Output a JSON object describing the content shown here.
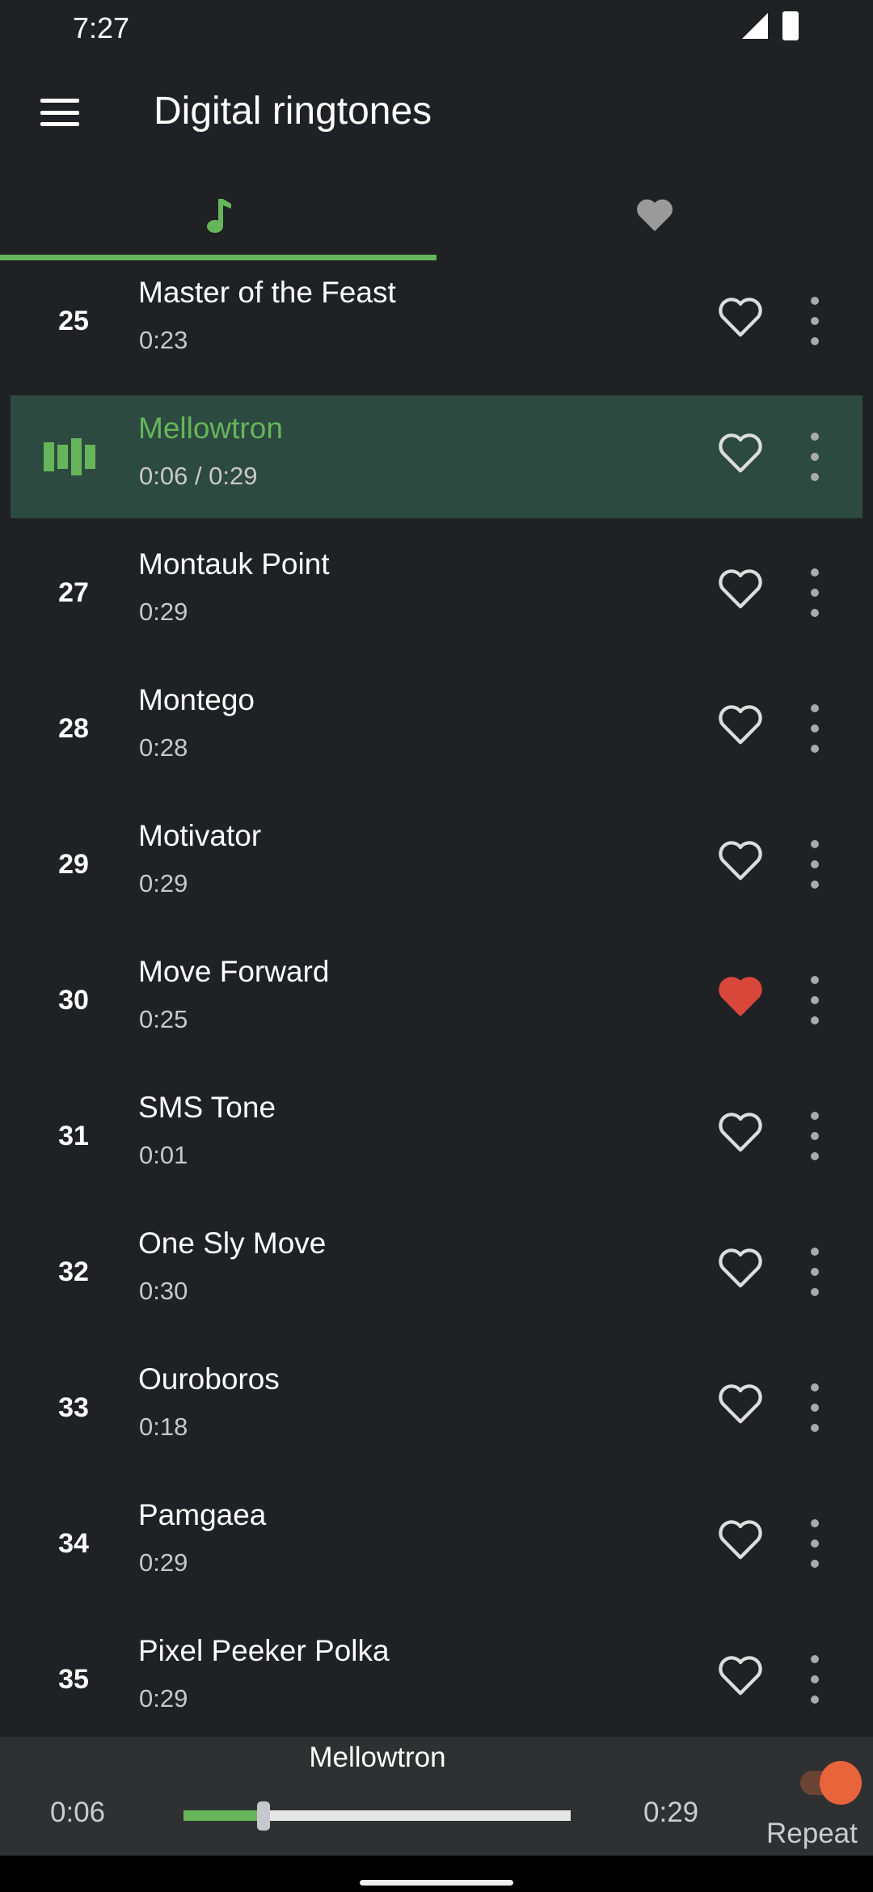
{
  "status": {
    "time": "7:27"
  },
  "toolbar": {
    "title": "Digital ringtones",
    "menu_icon": "hamburger-menu-icon"
  },
  "tabs": [
    {
      "icon": "music-note-icon",
      "selected": true
    },
    {
      "icon": "heart-icon",
      "selected": false
    }
  ],
  "colors": {
    "accent": "#66b55a",
    "favorite": "#d9463a",
    "toggle": "#e8643a",
    "background": "#202125"
  },
  "rows": [
    {
      "num": "25",
      "title": "Master of the Feast",
      "sub": "0:23",
      "fav": false
    },
    {
      "num": "",
      "title": "Mellowtron",
      "sub": "0:06 /  0:29",
      "fav": false,
      "playing": true
    },
    {
      "num": "27",
      "title": "Montauk Point",
      "sub": "0:29",
      "fav": false
    },
    {
      "num": "28",
      "title": "Montego",
      "sub": "0:28",
      "fav": false
    },
    {
      "num": "29",
      "title": "Motivator",
      "sub": "0:29",
      "fav": false
    },
    {
      "num": "30",
      "title": "Move Forward",
      "sub": "0:25",
      "fav": true
    },
    {
      "num": "31",
      "title": "SMS Tone",
      "sub": "0:01",
      "fav": false
    },
    {
      "num": "32",
      "title": "One Sly Move",
      "sub": "0:30",
      "fav": false
    },
    {
      "num": "33",
      "title": "Ouroboros",
      "sub": "0:18",
      "fav": false
    },
    {
      "num": "34",
      "title": "Pamgaea",
      "sub": "0:29",
      "fav": false
    },
    {
      "num": "35",
      "title": "Pixel Peeker Polka",
      "sub": "0:29",
      "fav": false
    }
  ],
  "player": {
    "title": "Mellowtron",
    "current": "0:06",
    "duration": "0:29",
    "progress": 0.207,
    "repeat_label": "Repeat",
    "repeat_on": true
  }
}
